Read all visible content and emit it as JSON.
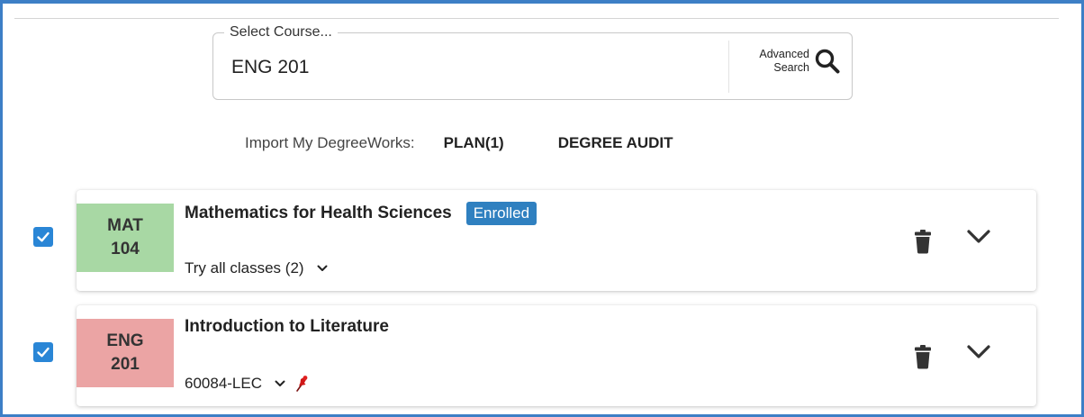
{
  "course_search": {
    "legend": "Select Course...",
    "value": "ENG 201",
    "advanced_line1": "Advanced",
    "advanced_line2": "Search"
  },
  "import": {
    "label": "Import My DegreeWorks:",
    "plan": "PLAN(1)",
    "degree_audit": "DEGREE AUDIT"
  },
  "courses": [
    {
      "checked": true,
      "subject": "MAT",
      "number": "104",
      "color": "#a8d8a4",
      "title": "Mathematics for Health Sciences",
      "badge": "Enrolled",
      "section": "Try all classes (2)"
    },
    {
      "checked": true,
      "subject": "ENG",
      "number": "201",
      "color": "#eba4a4",
      "title": "Introduction to Literature",
      "section": "60084-LEC",
      "pinned": true
    }
  ],
  "colors": {
    "frame": "#3d7fc6",
    "checkbox": "#2a86d6",
    "badge": "#2f80c0"
  }
}
